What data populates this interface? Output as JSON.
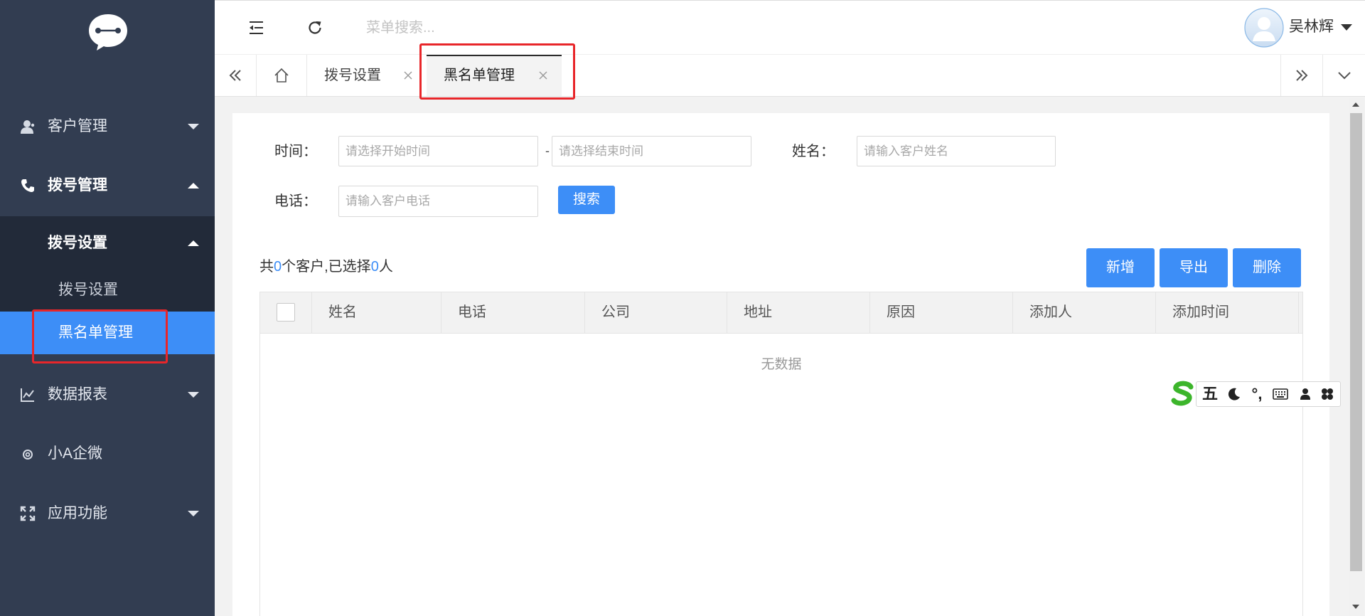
{
  "colors": {
    "sidebar_bg": "#323d51",
    "submenu_bg": "#222a39",
    "primary": "#3d8ef7",
    "highlight_box": "#e8262a",
    "ime_green": "#3cb52b"
  },
  "sidebar": {
    "logo_icon": "chat-bubble-logo-icon",
    "items": [
      {
        "label": "客户管理",
        "icon": "customer-icon",
        "expanded": false
      },
      {
        "label": "拨号管理",
        "icon": "phone-icon",
        "expanded": true,
        "children": [
          {
            "label": "拨号设置",
            "expanded": true,
            "children": [
              {
                "label": "拨号设置",
                "active": false
              },
              {
                "label": "黑名单管理",
                "active": true
              }
            ]
          }
        ]
      },
      {
        "label": "数据报表",
        "icon": "line-chart-icon",
        "expanded": false
      },
      {
        "label": "小A企微",
        "icon": "wecom-icon"
      },
      {
        "label": "应用功能",
        "icon": "expand-icon",
        "expanded": false
      }
    ]
  },
  "header": {
    "menu_toggle_icon": "indent-icon",
    "refresh_icon": "refresh-icon",
    "search_placeholder": "菜单搜索...",
    "user_name": "吴林辉"
  },
  "tabs": {
    "items": [
      {
        "label": "拨号设置",
        "active": false
      },
      {
        "label": "黑名单管理",
        "active": true
      }
    ]
  },
  "filter": {
    "time_label": "时间：",
    "start_placeholder": "请选择开始时间",
    "range_separator": "-",
    "end_placeholder": "请选择结束时间",
    "name_label": "姓名：",
    "name_placeholder": "请输入客户姓名",
    "phone_label": "电话：",
    "phone_placeholder": "请输入客户电话",
    "search_button": "搜索"
  },
  "summary": {
    "prefix": "共",
    "total": "0",
    "middle": "个客户,已选择",
    "selected": "0",
    "suffix": "人"
  },
  "actions": {
    "add": "新增",
    "export": "导出",
    "delete": "删除"
  },
  "table": {
    "columns": [
      "姓名",
      "电话",
      "公司",
      "地址",
      "原因",
      "添加人",
      "添加时间"
    ],
    "rows": [],
    "empty_text": "无数据"
  },
  "ime_toolbar": {
    "mode": "五",
    "punctuation": "°,"
  }
}
